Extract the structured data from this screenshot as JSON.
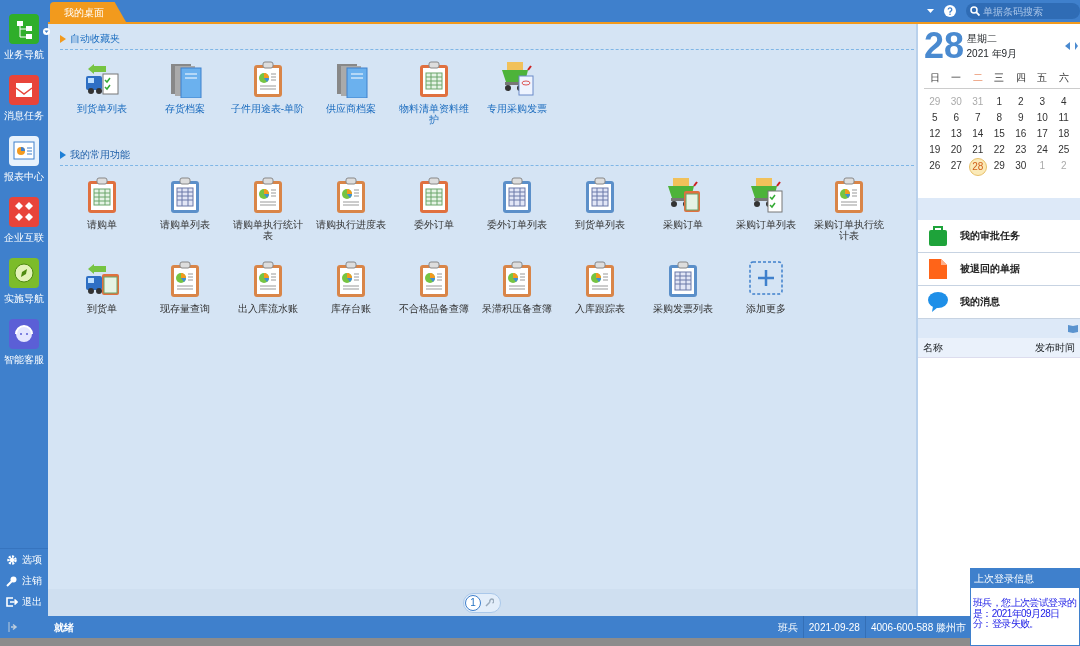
{
  "sidebar": {
    "items": [
      {
        "label": "业务导航",
        "kind": "tree",
        "dropdown": true
      },
      {
        "label": "消息任务",
        "kind": "mail",
        "dropdown": false
      },
      {
        "label": "报表中心",
        "kind": "report",
        "dropdown": false
      },
      {
        "label": "企业互联",
        "kind": "link",
        "dropdown": false
      },
      {
        "label": "实施导航",
        "kind": "compass",
        "dropdown": false
      },
      {
        "label": "智能客服",
        "kind": "service",
        "dropdown": false
      }
    ],
    "bottom_items": [
      {
        "label": "选项",
        "kind": "gear"
      },
      {
        "label": "注销",
        "kind": "key"
      },
      {
        "label": "退出",
        "kind": "exit"
      }
    ]
  },
  "tabs": [
    {
      "label": "我的桌面",
      "selected": true
    }
  ],
  "search": {
    "placeholder": "单据条码搜索"
  },
  "sections": [
    {
      "title": "自动收藏夹",
      "link_style": true,
      "items": [
        {
          "label": "到货单列表",
          "kind": "truck-check"
        },
        {
          "label": "存货档案",
          "kind": "books"
        },
        {
          "label": "子件用途表-单阶",
          "kind": "clip-chart"
        },
        {
          "label": "供应商档案",
          "kind": "books"
        },
        {
          "label": "物料清单资料维护",
          "kind": "clip-green"
        },
        {
          "label": "专用采购发票",
          "kind": "cart-invoice"
        }
      ]
    },
    {
      "title": "我的常用功能",
      "link_style": false,
      "items": [
        {
          "label": "请购单",
          "kind": "clip-green"
        },
        {
          "label": "请购单列表",
          "kind": "clip-blue"
        },
        {
          "label": "请购单执行统计表",
          "kind": "clip-chart"
        },
        {
          "label": "请购执行进度表",
          "kind": "clip-chart"
        },
        {
          "label": "委外订单",
          "kind": "clip-green"
        },
        {
          "label": "委外订单列表",
          "kind": "clip-blue"
        },
        {
          "label": "到货单列表",
          "kind": "clip-blue"
        },
        {
          "label": "采购订单",
          "kind": "cart-table"
        },
        {
          "label": "采购订单列表",
          "kind": "cart-check"
        },
        {
          "label": "采购订单执行统计表",
          "kind": "clip-chart"
        },
        {
          "label": "到货单",
          "kind": "truck-table"
        },
        {
          "label": "现存量查询",
          "kind": "clip-chart"
        },
        {
          "label": "出入库流水账",
          "kind": "clip-chart"
        },
        {
          "label": "库存台账",
          "kind": "clip-chart"
        },
        {
          "label": "不合格品备查簿",
          "kind": "clip-chart"
        },
        {
          "label": "呆滞积压备查簿",
          "kind": "clip-chart"
        },
        {
          "label": "入库跟踪表",
          "kind": "clip-chart"
        },
        {
          "label": "采购发票列表",
          "kind": "clip-blue"
        },
        {
          "label": "添加更多",
          "kind": "add"
        }
      ]
    }
  ],
  "pager": {
    "pages": [
      {
        "label": "1",
        "selected": true
      }
    ]
  },
  "calendar": {
    "day": "28",
    "weekday": "星期二",
    "month": "2021 年9月",
    "weekdays": [
      {
        "label": "日",
        "selected": false
      },
      {
        "label": "一",
        "selected": false
      },
      {
        "label": "二",
        "selected": true
      },
      {
        "label": "三",
        "selected": false
      },
      {
        "label": "四",
        "selected": false
      },
      {
        "label": "五",
        "selected": false
      },
      {
        "label": "六",
        "selected": false
      }
    ],
    "weeks": [
      [
        {
          "d": "29",
          "other": true,
          "selected": false
        },
        {
          "d": "30",
          "other": true,
          "selected": false
        },
        {
          "d": "31",
          "other": true,
          "selected": false
        },
        {
          "d": "1",
          "other": false,
          "selected": false
        },
        {
          "d": "2",
          "other": false,
          "selected": false
        },
        {
          "d": "3",
          "other": false,
          "selected": false
        },
        {
          "d": "4",
          "other": false,
          "selected": false
        }
      ],
      [
        {
          "d": "5",
          "other": false,
          "selected": false
        },
        {
          "d": "6",
          "other": false,
          "selected": false
        },
        {
          "d": "7",
          "other": false,
          "selected": false
        },
        {
          "d": "8",
          "other": false,
          "selected": false
        },
        {
          "d": "9",
          "other": false,
          "selected": false
        },
        {
          "d": "10",
          "other": false,
          "selected": false
        },
        {
          "d": "11",
          "other": false,
          "selected": false
        }
      ],
      [
        {
          "d": "12",
          "other": false,
          "selected": false
        },
        {
          "d": "13",
          "other": false,
          "selected": false
        },
        {
          "d": "14",
          "other": false,
          "selected": false
        },
        {
          "d": "15",
          "other": false,
          "selected": false
        },
        {
          "d": "16",
          "other": false,
          "selected": false
        },
        {
          "d": "17",
          "other": false,
          "selected": false
        },
        {
          "d": "18",
          "other": false,
          "selected": false
        }
      ],
      [
        {
          "d": "19",
          "other": false,
          "selected": false
        },
        {
          "d": "20",
          "other": false,
          "selected": false
        },
        {
          "d": "21",
          "other": false,
          "selected": false
        },
        {
          "d": "22",
          "other": false,
          "selected": false
        },
        {
          "d": "23",
          "other": false,
          "selected": false
        },
        {
          "d": "24",
          "other": false,
          "selected": false
        },
        {
          "d": "25",
          "other": false,
          "selected": false
        }
      ],
      [
        {
          "d": "26",
          "other": false,
          "selected": false
        },
        {
          "d": "27",
          "other": false,
          "selected": false
        },
        {
          "d": "28",
          "other": false,
          "selected": true
        },
        {
          "d": "29",
          "other": false,
          "selected": false
        },
        {
          "d": "30",
          "other": false,
          "selected": false
        },
        {
          "d": "1",
          "other": true,
          "selected": false
        },
        {
          "d": "2",
          "other": true,
          "selected": false
        }
      ]
    ]
  },
  "tasks": [
    {
      "label": "我的审批任务",
      "kind": "bag"
    },
    {
      "label": "被退回的单据",
      "kind": "doc"
    },
    {
      "label": "我的消息",
      "kind": "bubble"
    }
  ],
  "notice_table": {
    "columns": [
      "名称",
      "发布时间"
    ]
  },
  "status_bar": {
    "status": "就绪",
    "user": "班兵",
    "date": "2021-09-28",
    "phone": "4006-600-588 滕州市"
  },
  "login_popup": {
    "title": "上次登录信息",
    "lines": [
      "班兵，您上次尝试登录的",
      "是：2021年09月28日",
      "分：登录失败。"
    ]
  }
}
